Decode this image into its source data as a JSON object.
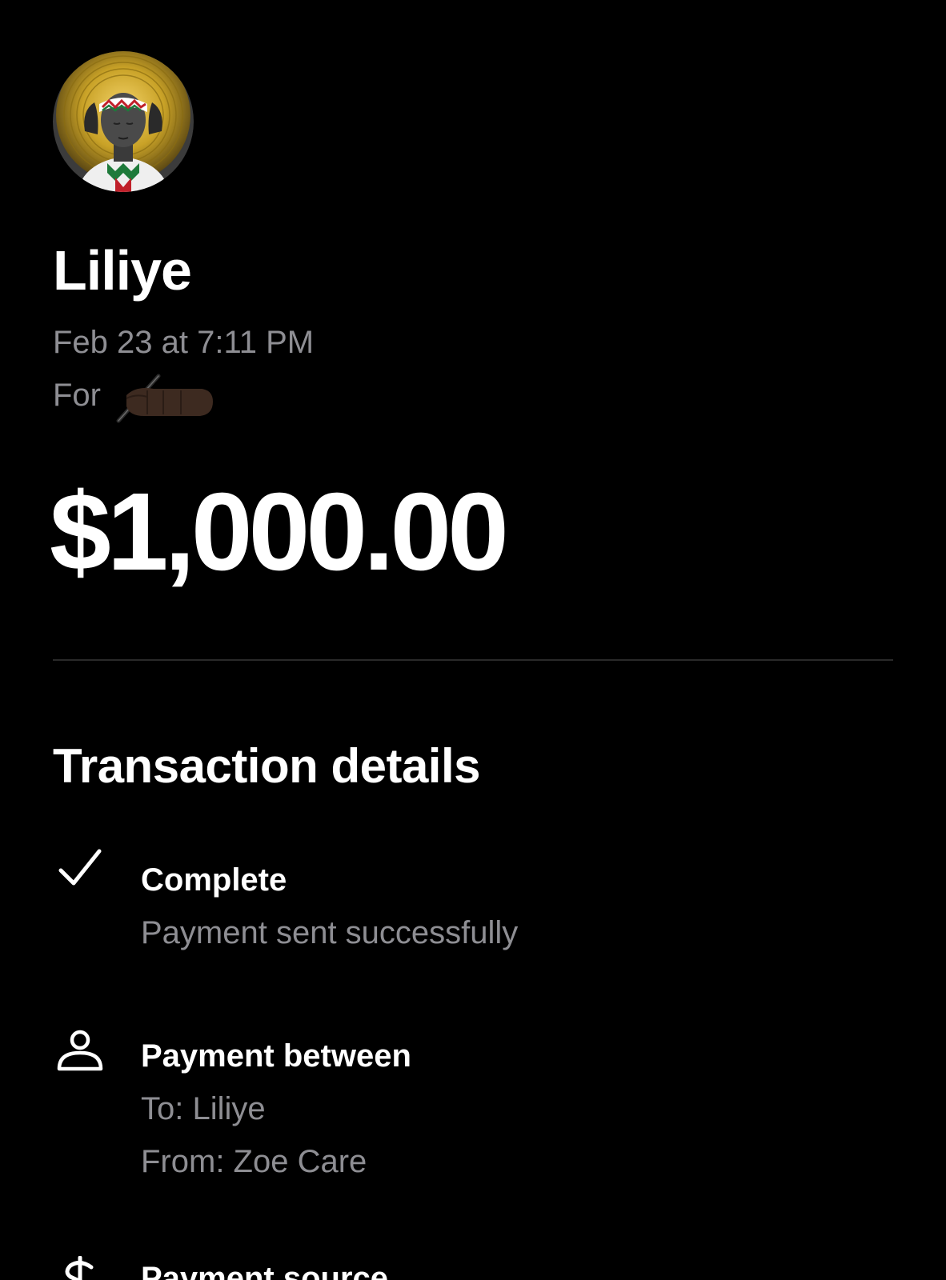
{
  "header": {
    "name": "Liliye",
    "date": "Feb 23 at 7:11 PM",
    "note_prefix": "For",
    "amount": "$1,000.00"
  },
  "details": {
    "title": "Transaction details",
    "status": {
      "icon": "checkmark-icon",
      "title": "Complete",
      "subtitle": "Payment sent successfully"
    },
    "parties": {
      "icon": "person-icon",
      "title": "Payment between",
      "to": "To: Liliye",
      "from": "From: Zoe Care"
    },
    "source": {
      "icon": "dollar-icon",
      "title": "Payment source"
    }
  },
  "colors": {
    "background": "#000000",
    "primary_text": "#ffffff",
    "secondary_text": "#8e8e93",
    "divider": "#2a2a2a",
    "avatar_halo": "#c9a227"
  }
}
